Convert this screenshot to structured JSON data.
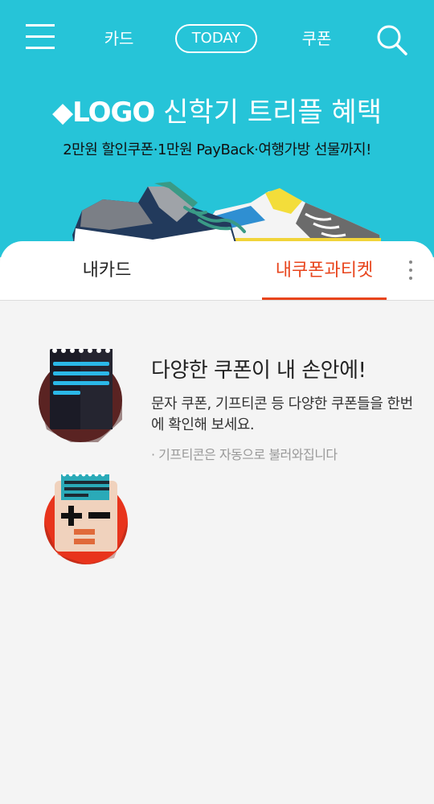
{
  "nav": {
    "menu_icon": "hamburger-menu-icon",
    "tabs": [
      {
        "label": "카드",
        "active": false
      },
      {
        "label": "TODAY",
        "active": true
      },
      {
        "label": "쿠폰",
        "active": false
      }
    ],
    "search_icon": "search-icon"
  },
  "promo": {
    "logo": "◆LOGO",
    "title": " 신학기 트리플 혜택",
    "subtitle": "2만원 할인쿠폰·1만원 PayBack·여행가방 선물까지!"
  },
  "tabs": [
    {
      "label": "내카드",
      "active": false
    },
    {
      "label": "내쿠폰과티켓",
      "active": true
    }
  ],
  "empty_state": {
    "title": "다양한 쿠폰이 내 손안에!",
    "description": "문자 쿠폰, 기프티콘 등 다양한 쿠폰들을 한번에 확인해 보세요.",
    "note": "· 기프티콘은 자동으로 불러와집니다"
  },
  "colors": {
    "header_bg": "#26c4d8",
    "accent": "#e8441c",
    "page_bg": "#f4f4f4"
  }
}
